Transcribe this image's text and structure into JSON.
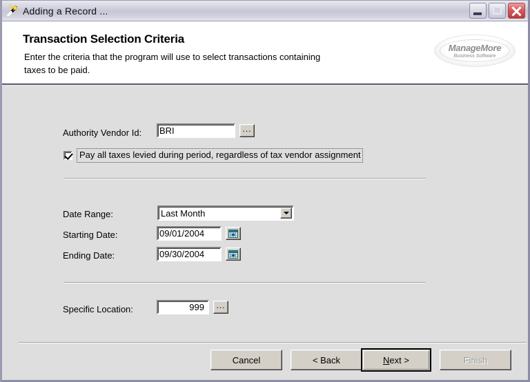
{
  "window": {
    "title": "Adding a Record ...",
    "icon": "magic-wand-icon",
    "controls": {
      "minimize": "minimize-button",
      "maximize": "maximize-button",
      "close": "close-button"
    }
  },
  "header": {
    "title": "Transaction Selection Criteria",
    "subtitle": "Enter the criteria that the program will use to select transactions containing taxes to be paid.",
    "logo": {
      "main": "ManageMore",
      "sub": "Business Software"
    }
  },
  "form": {
    "authority_vendor": {
      "label": "Authority Vendor Id:",
      "value": "BRI",
      "browse_label": "..."
    },
    "pay_all_taxes": {
      "label": "Pay all taxes levied during period, regardless of tax vendor assignment",
      "checked": true
    },
    "date_range": {
      "label": "Date Range:",
      "value": "Last Month"
    },
    "starting_date": {
      "label": "Starting Date:",
      "value": "09/01/2004",
      "picker": "calendar-icon"
    },
    "ending_date": {
      "label": "Ending Date:",
      "value": "09/30/2004",
      "picker": "calendar-icon"
    },
    "specific_location": {
      "label": "Specific Location:",
      "value": "999",
      "browse_label": "..."
    }
  },
  "footer": {
    "cancel": "Cancel",
    "back": "< Back",
    "next_prefix": "N",
    "next_suffix": "ext >",
    "finish": "Finish"
  },
  "colors": {
    "dialog_face": "#dededf",
    "header_bg": "#ffffff",
    "close_button": "#d85b5b",
    "calendar_icon": "#2d7d8c",
    "disabled_text": "#9a9a9a"
  }
}
